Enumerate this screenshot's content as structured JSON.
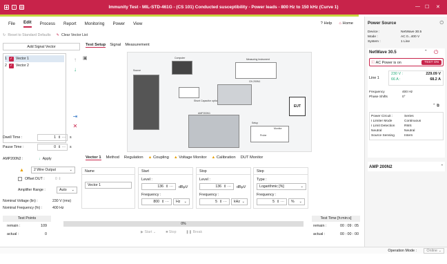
{
  "titlebar": {
    "title": "Immunity Test - MIL-STD-461G - (CS 101) Conducted susceptibility - Power leads - 800 Hz to 150 kHz (Curve 1)"
  },
  "menu": {
    "items": [
      "File",
      "Edit",
      "Process",
      "Report",
      "Monitoring",
      "Power",
      "View"
    ],
    "active": "Edit",
    "help": "Help",
    "home": "Home"
  },
  "toolbar": {
    "reset": "Reset to Standard Defaults",
    "clear": "Clear Vector List"
  },
  "left": {
    "add_vector": "Add Signal Vector",
    "vectors": [
      {
        "num": "1",
        "label": "Vector 1"
      },
      {
        "num": "2",
        "label": "Vector 2"
      }
    ],
    "dwell_label": "Dwell Time :",
    "dwell_value": "1",
    "dwell_unit": "s",
    "pause_label": "Pause Time :",
    "pause_value": "0",
    "pause_unit": "s",
    "amp_label": "AMP200N2 :",
    "apply": "Apply",
    "output": "2 Wire Output",
    "offset_label": "Offset DUT :",
    "offset_value": "0",
    "range_label": "Amplifier Range :",
    "range_value": "Auto",
    "nom_v_label": "Nominal Voltage (lin) :",
    "nom_v_value": "230 V (rms)",
    "nom_f_label": "Nominal Frequency (fn) :",
    "nom_f_value": "400 Hz"
  },
  "tabs_top": [
    "Test Setup",
    "Signal",
    "Measurement"
  ],
  "diagram": {
    "computer": "Computer",
    "source": "Source",
    "measuring": "Measuring Instrument",
    "cn": "CN 200N1",
    "shunt": "Shunt Capacitor optional",
    "amp": "AMP200N1",
    "eut": "EUT",
    "setup": "Setup",
    "monitor": "Monitor",
    "probe": "Probe"
  },
  "tabs_vec": [
    "Vector 1",
    "Method",
    "Regulation",
    "Coupling",
    "Voltage Monitor",
    "Calibration",
    "DUT Monitor"
  ],
  "name_col": {
    "header": "Name",
    "value": "Vector 1"
  },
  "start_col": {
    "header": "Start",
    "level_label": "Level :",
    "level": "136",
    "level_unit": "dBµV",
    "freq_label": "Frequency :",
    "freq": "800",
    "freq_unit": "Hz"
  },
  "stop_col": {
    "header": "Stop",
    "level_label": "Level :",
    "level": "136",
    "level_unit": "dBµV",
    "freq_label": "Frequency :",
    "freq": "5",
    "freq_unit": "kHz"
  },
  "step_col": {
    "header": "Step",
    "type_label": "Type :",
    "type": "Logarithmic [%]",
    "freq_label": "Frequency :",
    "freq": "5",
    "freq_unit": "%"
  },
  "test_points": {
    "header": "Test Points",
    "remain_label": "remain :",
    "remain": "109",
    "actual_label": "actual :",
    "actual": "0"
  },
  "progress": {
    "value": "0%",
    "fraction": 0.0
  },
  "buttons": {
    "start": "Start",
    "stop": "Stop",
    "break": "Break"
  },
  "test_time": {
    "header": "Test Time [h:min:s]",
    "remain_label": "remain :",
    "remain": "00 : 09 : 05",
    "actual_label": "actual :",
    "actual": "00 : 00 : 00"
  },
  "right": {
    "power_source": "Power Source",
    "device_label": "Device :",
    "device": "NetWave 30.5",
    "mode_label": "Mode :",
    "mode": "AC 0...400 V",
    "system_label": "System :",
    "system": "1 Line",
    "nw": "NetWave 30.5",
    "ac_on": "AC Power is on",
    "test_on": "TEST ON",
    "line": "Line 1",
    "v_set": "230 V :",
    "v_act": "229.09 V",
    "i_set": "66 A :",
    "i_act": "68.2 A",
    "freq_label": "Frequency",
    "freq": "400 Hz",
    "phase_label": "Phase Shifts",
    "phase": "0°",
    "pc_label": "Power Circuit :",
    "pc": "Series",
    "il_label": "I Limiter Mode",
    "il": "Continuous",
    "ild_label": "I Limit Detection",
    "ild": "RMS",
    "neut_label": "Neutral",
    "neut": "Neutral",
    "ss_label": "Source Sensing",
    "ss": "Intern",
    "amp": "AMP 200N2"
  },
  "status": {
    "op_label": "Operation Mode :",
    "op": "Online"
  }
}
